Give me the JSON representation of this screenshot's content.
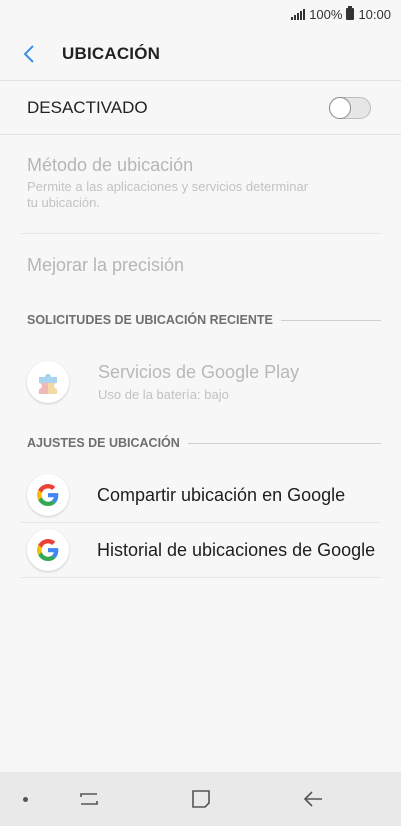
{
  "status_bar": {
    "battery_pct": "100%",
    "time": "10:00"
  },
  "header": {
    "title": "UBICACIÓN"
  },
  "master": {
    "label": "DESACTIVADO",
    "enabled": false
  },
  "items": {
    "method": {
      "title": "Método de ubicación",
      "subtitle_line1": "Permite a las aplicaciones y servicios determinar",
      "subtitle_line2": "tu ubicación."
    },
    "accuracy": {
      "title": "Mejorar la precisión"
    }
  },
  "recent": {
    "header": "SOLICITUDES DE UBICACIÓN RECIENTE",
    "apps": [
      {
        "title": "Servicios de Google Play",
        "subtitle": "Uso de la batería: bajo",
        "icon": "google-play-services-icon"
      }
    ]
  },
  "settings": {
    "header": "AJUSTES DE UBICACIÓN",
    "items": [
      {
        "title": "Compartir ubicación en Google",
        "icon": "google-g-icon"
      },
      {
        "title": "Historial de ubicaciones de Google",
        "icon": "google-g-icon"
      }
    ]
  },
  "colors": {
    "accent": "#3d8ee8",
    "background": "#f7f7f7",
    "disabled_text": "#b6b6b6",
    "nav_bar": "#e9e9e9"
  }
}
